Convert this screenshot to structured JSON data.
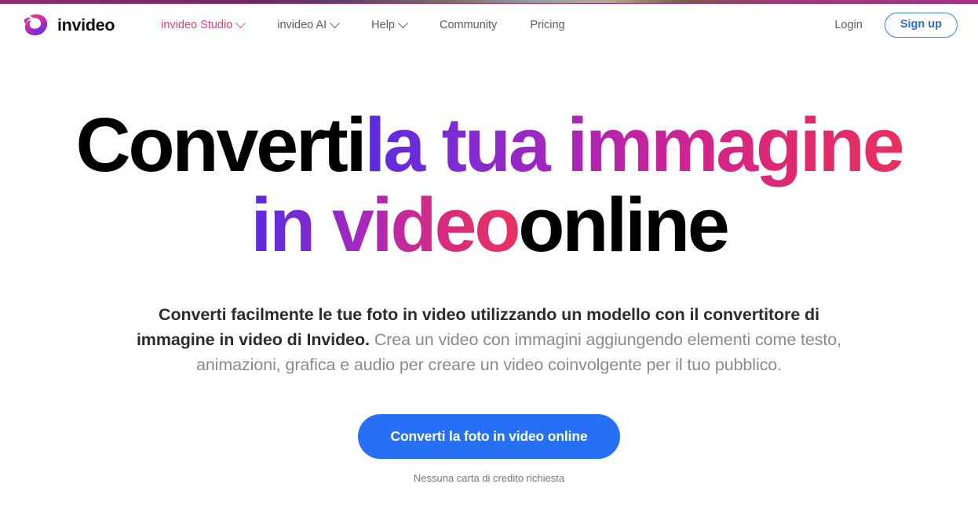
{
  "brand": {
    "name": "invideo",
    "logo_icon": "invideo-bird-logo",
    "logo_gradient_from": "#ef3d8a",
    "logo_gradient_to": "#6b2ce0"
  },
  "nav": {
    "items": [
      {
        "label": "invideo Studio",
        "has_dropdown": true,
        "active": true
      },
      {
        "label": "invideo AI",
        "has_dropdown": true,
        "active": false
      },
      {
        "label": "Help",
        "has_dropdown": true,
        "active": false
      },
      {
        "label": "Community",
        "has_dropdown": false,
        "active": false
      },
      {
        "label": "Pricing",
        "has_dropdown": false,
        "active": false
      }
    ],
    "login_label": "Login",
    "signup_label": "Sign up",
    "accent_active": "#e0407f",
    "signup_border": "#3d7fd8"
  },
  "hero": {
    "headline_line1_black": "Converti",
    "headline_line1_gradient": "la tua immagine",
    "headline_line2_gradient": "in video",
    "headline_line2_black": "online",
    "subtitle_strong": "Converti facilmente le tue foto in video utilizzando un modello con il convertitore di immagine in video di Invideo.",
    "subtitle_rest": " Crea un video con immagini aggiungendo elementi come testo, animazioni, grafica e audio per creare un video coinvolgente per il tuo pubblico.",
    "cta_label": "Converti la foto in video online",
    "cta_note": "Nessuna carta di credito richiesta",
    "cta_color": "#2670f5",
    "gradient_start": "#5b2be0",
    "gradient_end": "#e8305f"
  }
}
